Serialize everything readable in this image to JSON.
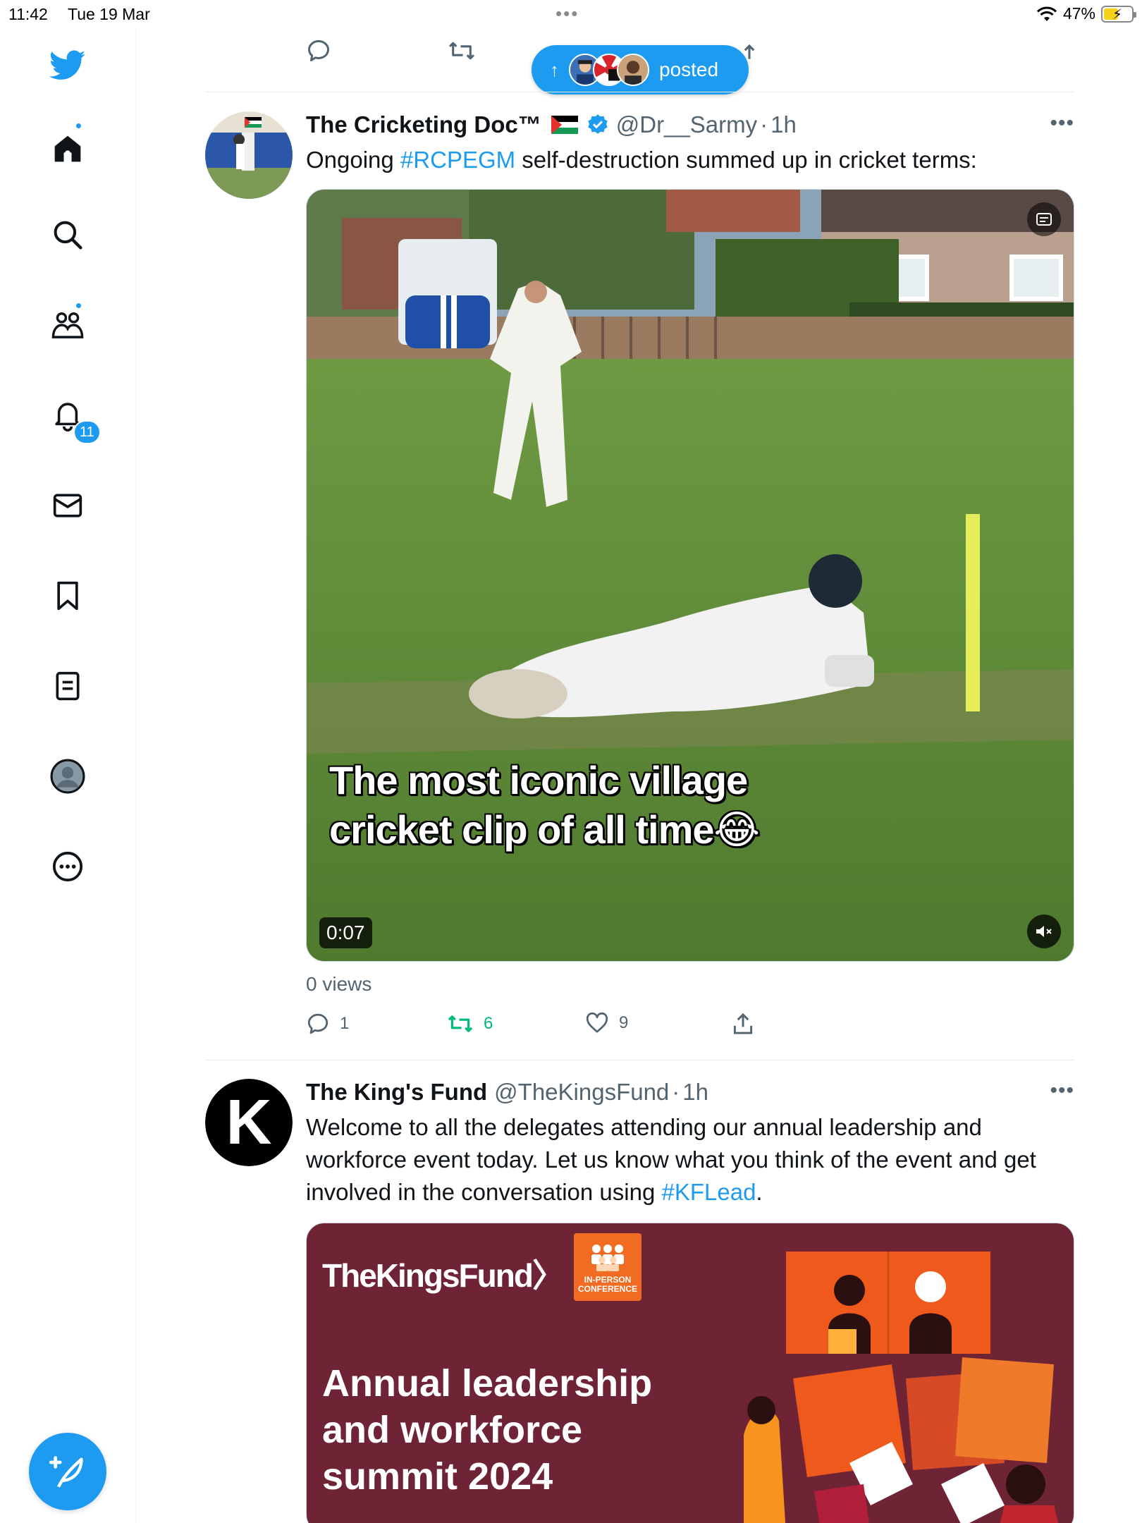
{
  "status_bar": {
    "time": "11:42",
    "date": "Tue 19 Mar",
    "dots": "•••",
    "battery": "47%",
    "battery_level": 0.47
  },
  "sidebar": {
    "notifications_badge": "11"
  },
  "new_posts_pill": {
    "arrow": "↑",
    "label": "posted"
  },
  "tweets": [
    {
      "name": "The Cricketing Doc™",
      "handle": "@Dr__Sarmy",
      "time": "1h",
      "more": "•••",
      "text_before": "Ongoing ",
      "hashtag": "#RCPEGM",
      "text_after": " self-destruction summed up in cricket terms:",
      "video": {
        "caption_line1": "The most iconic village",
        "caption_line2": "cricket clip of all time😂",
        "duration": "0:07"
      },
      "views": "0 views",
      "replies": "1",
      "reposts": "6",
      "likes": "9"
    },
    {
      "name": "The King's Fund",
      "handle": "@TheKingsFund",
      "time": "1h",
      "more": "•••",
      "text_line1": "Welcome to all the delegates attending our annual leadership and",
      "text_line2": "workforce event today. Let us know what you think of the event and get",
      "text_line3_before": "involved in the conversation using ",
      "hashtag": "#KFLead",
      "text_line3_after": ".",
      "image": {
        "logo": "TheKingsFund〉",
        "badge_line1": "IN-PERSON",
        "badge_line2": "CONFERENCE",
        "title_line1": "Annual leadership",
        "title_line2": "and workforce",
        "title_line3": "summit 2024"
      }
    }
  ],
  "colors": {
    "accent": "#1d9bf0",
    "repost_green": "#00ba7c",
    "kf_burgundy": "#6e2435",
    "kf_orange": "#f26b22"
  }
}
